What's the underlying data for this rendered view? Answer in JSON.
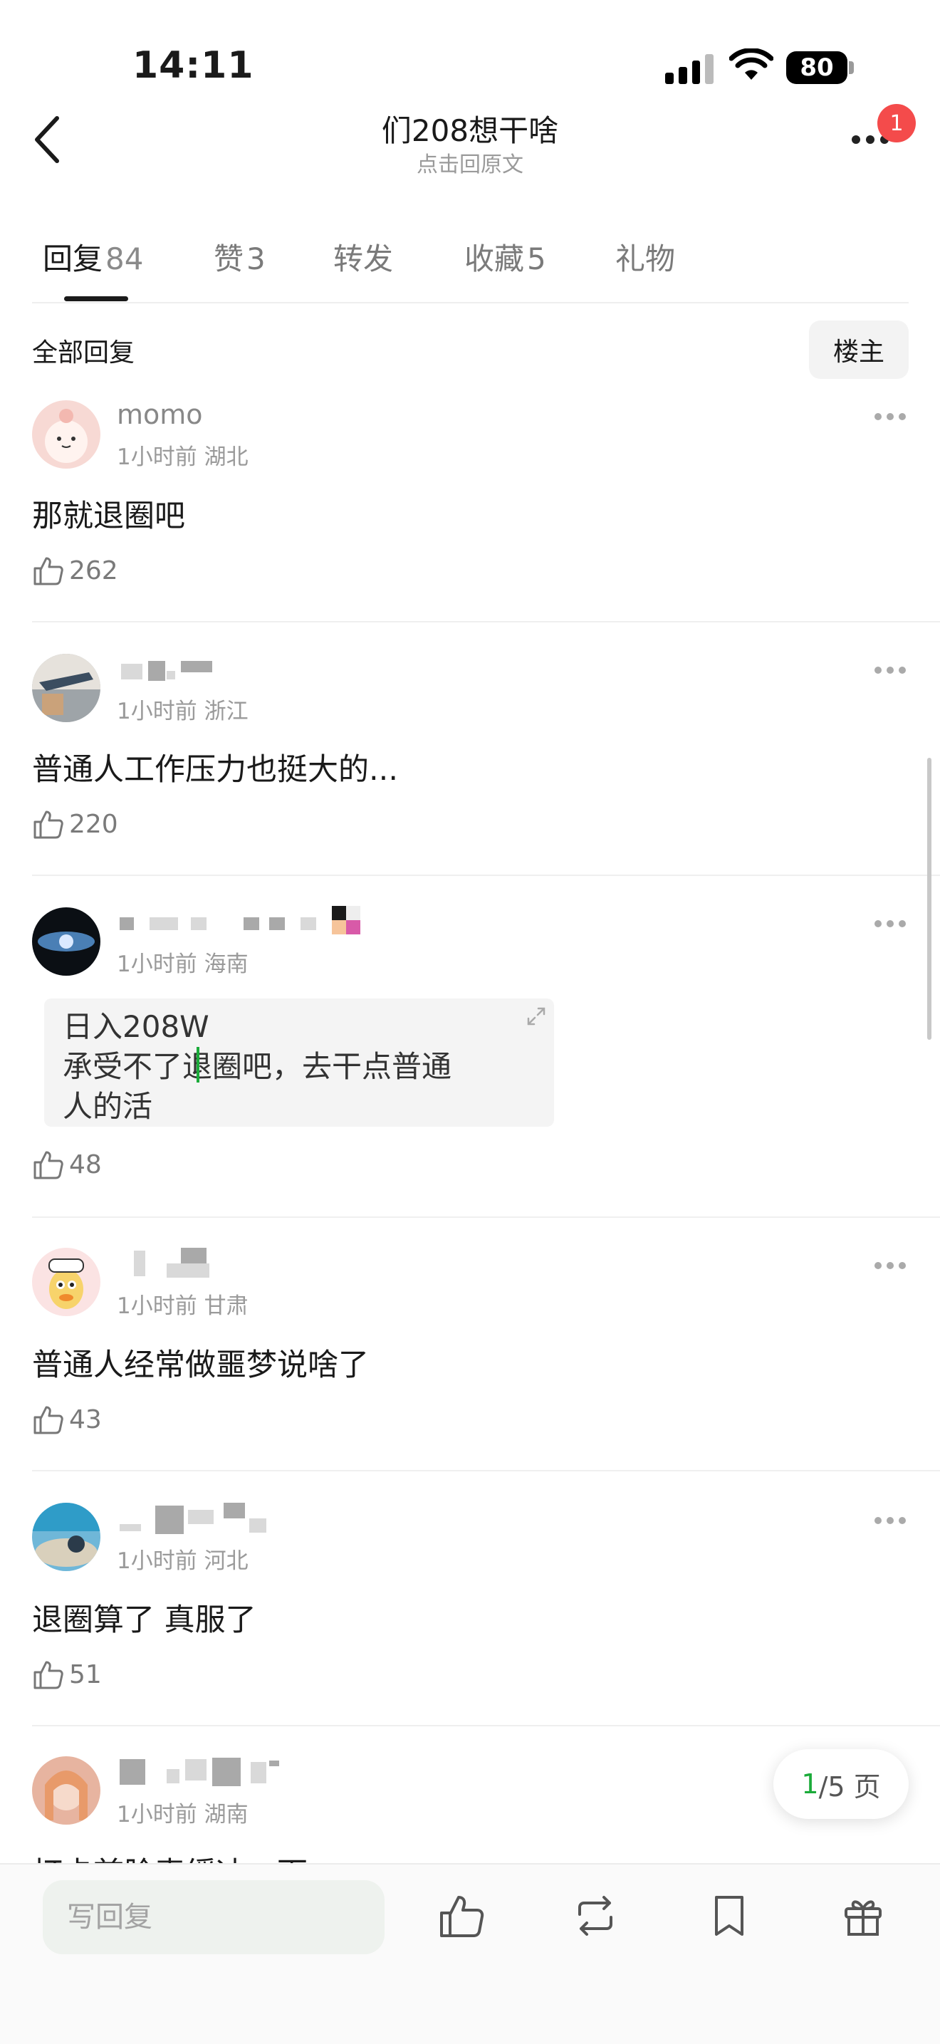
{
  "status_bar": {
    "time": "14:11",
    "battery": "80"
  },
  "header": {
    "title": "们208想干啥",
    "subtitle": "点击回原文",
    "notification_count": "1"
  },
  "tabs": [
    {
      "label": "回复",
      "count": "84"
    },
    {
      "label": "赞",
      "count": "3"
    },
    {
      "label": "转发",
      "count": ""
    },
    {
      "label": "收藏",
      "count": "5"
    },
    {
      "label": "礼物",
      "count": ""
    }
  ],
  "section": {
    "all_replies": "全部回复",
    "owner_only": "楼主"
  },
  "comments": [
    {
      "username": "momo",
      "time": "1小时前",
      "location": "湖北",
      "text": "那就退圈吧",
      "likes": "262"
    },
    {
      "username": "",
      "time": "1小时前",
      "location": "浙江",
      "text": "普通人工作压力也挺大的...",
      "likes": "220"
    },
    {
      "username": "",
      "time": "1小时前",
      "location": "海南",
      "quote_lines": [
        "日入208W",
        "承受不了退圈吧，去干点普通",
        "人的活"
      ],
      "likes": "48"
    },
    {
      "username": "",
      "time": "1小时前",
      "location": "甘肃",
      "text": "普通人经常做噩梦说啥了",
      "likes": "43"
    },
    {
      "username": "",
      "time": "1小时前",
      "location": "河北",
      "text": "退圈算了  真服了",
      "likes": "51"
    },
    {
      "username": "",
      "time": "1小时前",
      "location": "湖南",
      "text": "打卡首脸表缓冲一下",
      "likes": ""
    }
  ],
  "pager": {
    "current": "1",
    "total": "/5 页"
  },
  "bottom_bar": {
    "reply_placeholder": "写回复"
  },
  "colors": {
    "accent_green": "#1bab3a",
    "badge_red": "#f44b4b"
  }
}
